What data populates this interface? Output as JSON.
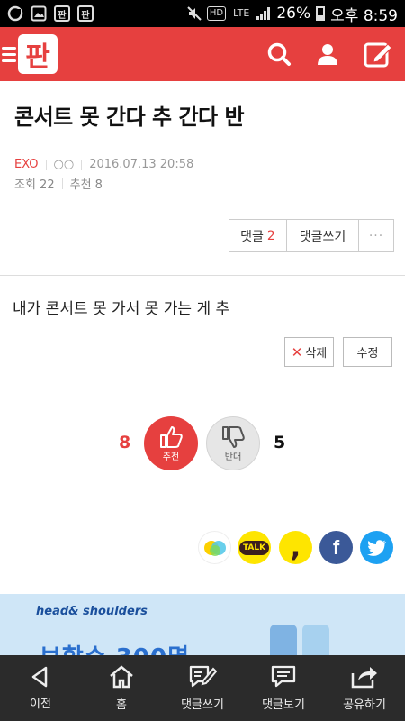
{
  "status_bar": {
    "carrier_tag": "HD",
    "network": "LTE",
    "battery": "26%",
    "time": "오후 8:59",
    "app_icons": [
      "판",
      "판"
    ]
  },
  "header": {
    "logo": "판",
    "icons": [
      "menu-icon",
      "search-icon",
      "user-icon",
      "write-icon"
    ]
  },
  "post": {
    "title": "콘서트 못 간다 추 간다 반",
    "author": "EXO",
    "author_id": "○○",
    "date": "2016.07.13 20:58",
    "views_label": "조회 22",
    "likes_label": "추천 8",
    "comment_button": "댓글",
    "comment_count": "2",
    "write_comment_button": "댓글쓰기",
    "more_button": "···"
  },
  "comment": {
    "text": "내가 콘서트 못 가서 못 가는 게 추",
    "delete_button": "삭제",
    "edit_button": "수정"
  },
  "votes": {
    "up_count": "8",
    "up_label": "추천",
    "down_count": "5",
    "down_label": "반대"
  },
  "share": {
    "kakao_talk_label": "TALK",
    "kakao_story_label": ",",
    "facebook_label": "f"
  },
  "ad": {
    "brand": "head& shoulders",
    "headline": "보합수 300명"
  },
  "bottom_nav": {
    "items": [
      {
        "label": "이전",
        "icon": "back-icon"
      },
      {
        "label": "홈",
        "icon": "home-icon"
      },
      {
        "label": "댓글쓰기",
        "icon": "write-comment-icon"
      },
      {
        "label": "댓글보기",
        "icon": "view-comment-icon"
      },
      {
        "label": "공유하기",
        "icon": "share-icon"
      }
    ]
  },
  "colors": {
    "brand_red": "#e6403f",
    "nav_dark": "#2b2b2b",
    "facebook": "#3b5998",
    "twitter": "#1da1f2",
    "kakao_yellow": "#fee500"
  }
}
